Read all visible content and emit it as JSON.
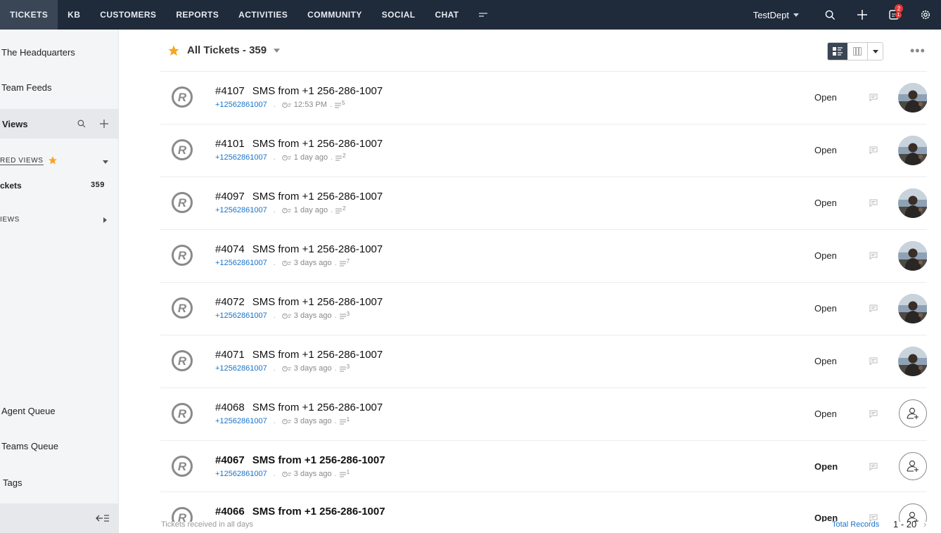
{
  "nav": {
    "tabs": [
      "TICKETS",
      "KB",
      "CUSTOMERS",
      "REPORTS",
      "ACTIVITIES",
      "COMMUNITY",
      "SOCIAL",
      "CHAT"
    ],
    "active_tab": "TICKETS",
    "department": "TestDept",
    "notif_count": "2",
    "notif_count_2": "1"
  },
  "sidebar": {
    "headquarters": "The Headquarters",
    "team_feeds": "Team Feeds",
    "views_label": "Views",
    "starred_views": "RED VIEWS",
    "all_tickets": "ckets",
    "all_tickets_count": "359",
    "other_views": "IEWS",
    "agent_queue": "Agent Queue",
    "teams_queue": "Teams Queue",
    "tags": "Tags"
  },
  "main": {
    "view_title": "All Tickets - 359",
    "footer_left": "Tickets received in all days",
    "footer_right": "Total Records",
    "page_range": "1 - 20"
  },
  "tickets": [
    {
      "num": "#4107",
      "subject": "SMS from +1 256-286-1007",
      "phone": "+12562861007",
      "time": "12:53 PM",
      "threads": "5",
      "status": "Open",
      "assigned": true,
      "unread": false
    },
    {
      "num": "#4101",
      "subject": "SMS from +1 256-286-1007",
      "phone": "+12562861007",
      "time": "1 day ago",
      "threads": "2",
      "status": "Open",
      "assigned": true,
      "unread": false
    },
    {
      "num": "#4097",
      "subject": "SMS from +1 256-286-1007",
      "phone": "+12562861007",
      "time": "1 day ago",
      "threads": "2",
      "status": "Open",
      "assigned": true,
      "unread": false
    },
    {
      "num": "#4074",
      "subject": "SMS from +1 256-286-1007",
      "phone": "+12562861007",
      "time": "3 days ago",
      "threads": "7",
      "status": "Open",
      "assigned": true,
      "unread": false
    },
    {
      "num": "#4072",
      "subject": "SMS from +1 256-286-1007",
      "phone": "+12562861007",
      "time": "3 days ago",
      "threads": "3",
      "status": "Open",
      "assigned": true,
      "unread": false
    },
    {
      "num": "#4071",
      "subject": "SMS from +1 256-286-1007",
      "phone": "+12562861007",
      "time": "3 days ago",
      "threads": "3",
      "status": "Open",
      "assigned": true,
      "unread": false
    },
    {
      "num": "#4068",
      "subject": "SMS from +1 256-286-1007",
      "phone": "+12562861007",
      "time": "3 days ago",
      "threads": "1",
      "status": "Open",
      "assigned": false,
      "unread": false
    },
    {
      "num": "#4067",
      "subject": "SMS from +1 256-286-1007",
      "phone": "+12562861007",
      "time": "3 days ago",
      "threads": "1",
      "status": "Open",
      "assigned": false,
      "unread": true
    },
    {
      "num": "#4066",
      "subject": "SMS from +1 256-286-1007",
      "phone": "",
      "time": "",
      "threads": "",
      "status": "Open",
      "assigned": false,
      "unread": true
    }
  ],
  "colors": {
    "nav_bg": "#1f2a3a",
    "accent_blue": "#1a73c8",
    "star": "#f5a623",
    "badge": "#e53935"
  }
}
